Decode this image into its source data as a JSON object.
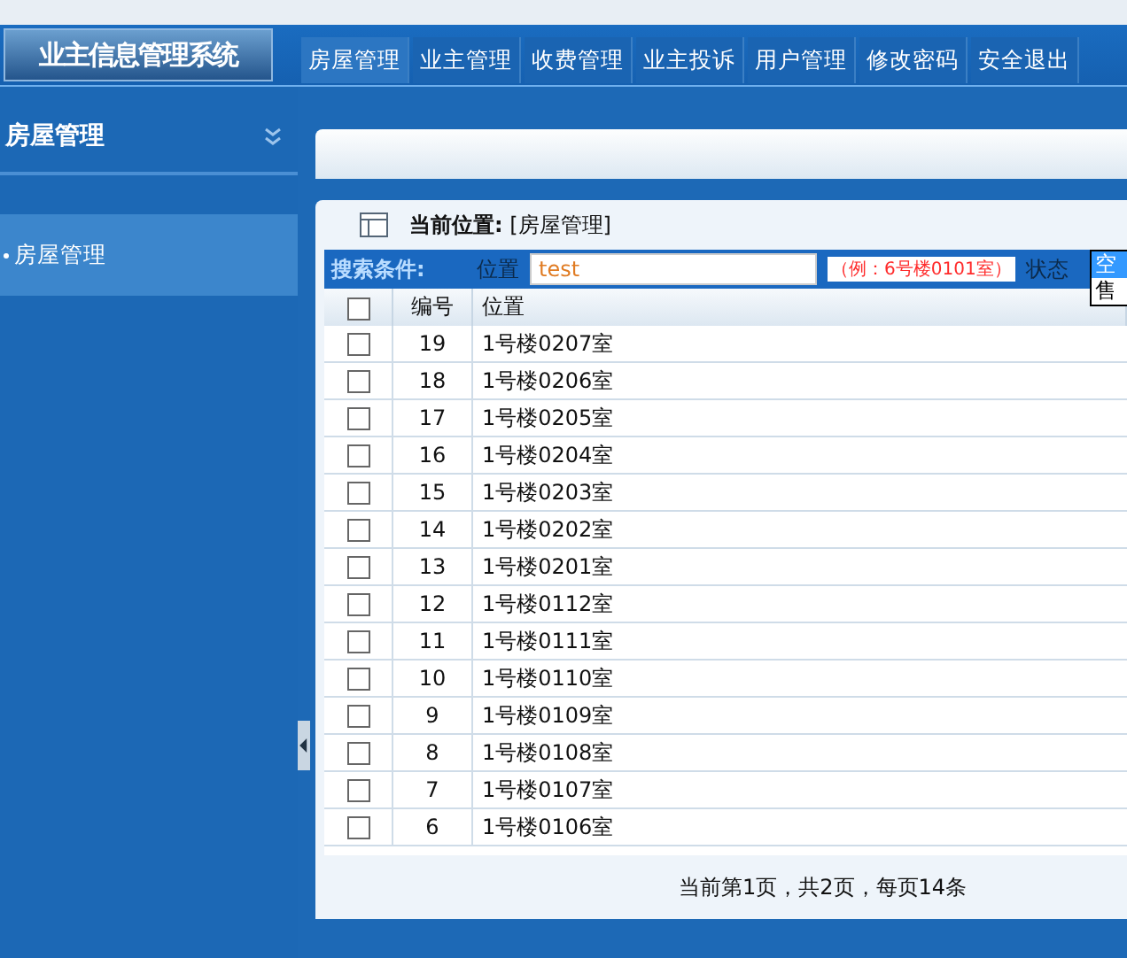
{
  "app": {
    "title": "业主信息管理系统"
  },
  "nav": [
    {
      "label": "房屋管理",
      "selected": true
    },
    {
      "label": "业主管理",
      "selected": false
    },
    {
      "label": "收费管理",
      "selected": false
    },
    {
      "label": "业主投诉",
      "selected": false
    },
    {
      "label": "用户管理",
      "selected": false
    },
    {
      "label": "修改密码",
      "selected": false
    },
    {
      "label": "安全退出",
      "selected": false
    }
  ],
  "sidebar": {
    "title": "房屋管理",
    "items": [
      {
        "label": "房屋管理",
        "selected": true
      }
    ]
  },
  "breadcrumb": {
    "label": "当前位置:",
    "value": "[房屋管理]"
  },
  "search": {
    "title": "搜索条件:",
    "location_label": "位置",
    "location_value": "test",
    "hint": "（例：6号楼0101室）",
    "status_label": "状态",
    "status_options": [
      {
        "label": "空",
        "selected": true
      },
      {
        "label": "售",
        "selected": false
      }
    ]
  },
  "table": {
    "all_checked": false,
    "columns": [
      "编号",
      "位置"
    ],
    "rows": [
      {
        "checked": false,
        "id": "19",
        "location": "1号楼0207室"
      },
      {
        "checked": false,
        "id": "18",
        "location": "1号楼0206室"
      },
      {
        "checked": false,
        "id": "17",
        "location": "1号楼0205室"
      },
      {
        "checked": false,
        "id": "16",
        "location": "1号楼0204室"
      },
      {
        "checked": false,
        "id": "15",
        "location": "1号楼0203室"
      },
      {
        "checked": false,
        "id": "14",
        "location": "1号楼0202室"
      },
      {
        "checked": false,
        "id": "13",
        "location": "1号楼0201室"
      },
      {
        "checked": false,
        "id": "12",
        "location": "1号楼0112室"
      },
      {
        "checked": false,
        "id": "11",
        "location": "1号楼0111室"
      },
      {
        "checked": false,
        "id": "10",
        "location": "1号楼0110室"
      },
      {
        "checked": false,
        "id": "9",
        "location": "1号楼0109室"
      },
      {
        "checked": false,
        "id": "8",
        "location": "1号楼0108室"
      },
      {
        "checked": false,
        "id": "7",
        "location": "1号楼0107室"
      },
      {
        "checked": false,
        "id": "6",
        "location": "1号楼0106室"
      }
    ]
  },
  "pagination": "当前第1页，共2页，每页14条"
}
